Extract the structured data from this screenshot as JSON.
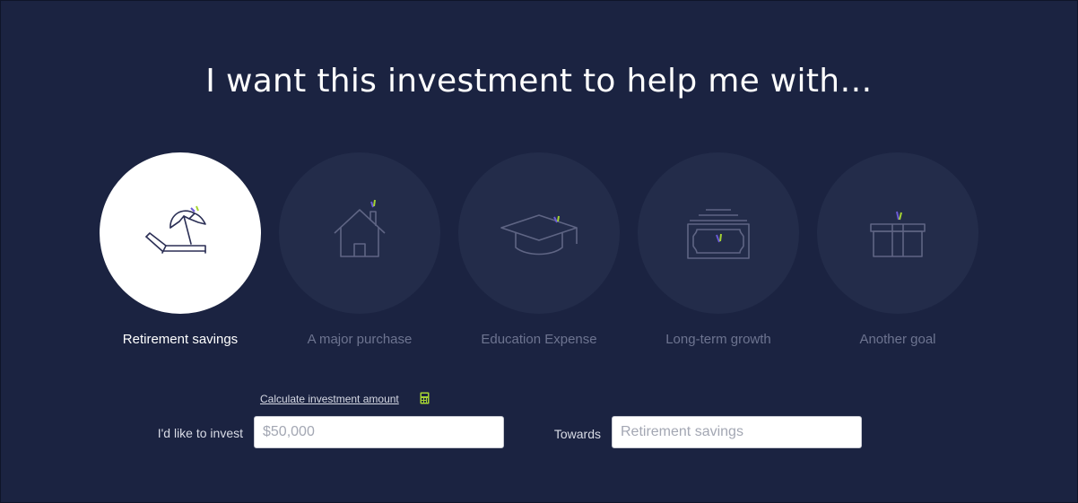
{
  "heading": "I want this investment to help me with…",
  "goals": [
    {
      "label": "Retirement savings",
      "icon": "beach-chair-umbrella-icon",
      "selected": true
    },
    {
      "label": "A major purchase",
      "icon": "house-icon",
      "selected": false
    },
    {
      "label": "Education Expense",
      "icon": "graduation-cap-icon",
      "selected": false
    },
    {
      "label": "Long-term growth",
      "icon": "money-stack-icon",
      "selected": false
    },
    {
      "label": "Another goal",
      "icon": "gift-box-icon",
      "selected": false
    }
  ],
  "form": {
    "calculate_link": "Calculate investment amount",
    "calculate_icon": "calculator-icon",
    "invest_label": "I'd like to invest",
    "invest_placeholder": "$50,000",
    "towards_label": "Towards",
    "towards_placeholder": "Retirement savings"
  },
  "colors": {
    "background": "#1b2341",
    "circle": "#232c4a",
    "selected_circle": "#ffffff",
    "accent_green": "#a6d433",
    "accent_purple": "#6b5bd6"
  }
}
